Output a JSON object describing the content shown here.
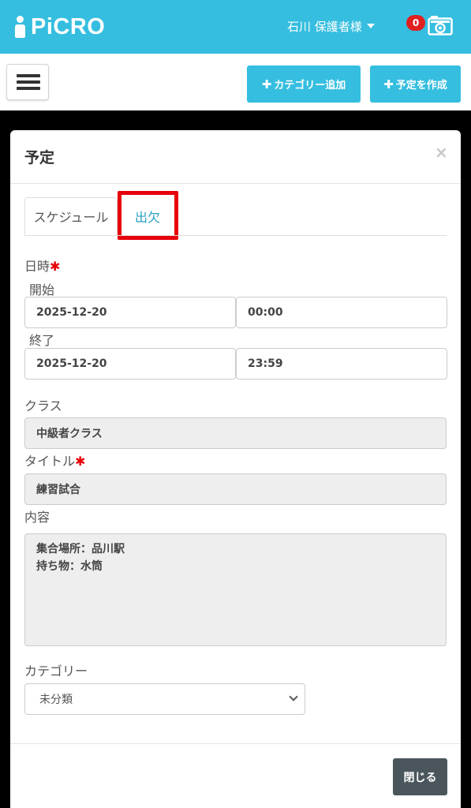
{
  "header": {
    "logo_text": "PiCRO",
    "user_label": "石川 保護者様",
    "notification_count": "0",
    "brand_color": "#35bedf"
  },
  "toolbar": {
    "add_category_label": "カテゴリー追加",
    "create_event_label": "予定を作成"
  },
  "modal": {
    "title": "予定",
    "close_glyph": "×",
    "tabs": [
      {
        "label": "スケジュール",
        "active": true
      },
      {
        "label": "出欠",
        "active": false,
        "highlighted": true
      }
    ],
    "datetime_label": "日時",
    "required_mark": "✱",
    "start_label": "開始",
    "start_date": "2025-12-20",
    "start_time": "00:00",
    "end_label": "終了",
    "end_date": "2025-12-20",
    "end_time": "23:59",
    "class_label": "クラス",
    "class_value": "中級者クラス",
    "title_label": "タイトル",
    "title_value": "練習試合",
    "content_label": "内容",
    "content_lines": [
      "集合場所：品川駅",
      "持ち物：水筒"
    ],
    "category_label": "カテゴリー",
    "category_value": "未分類",
    "close_button": "閉じる"
  }
}
